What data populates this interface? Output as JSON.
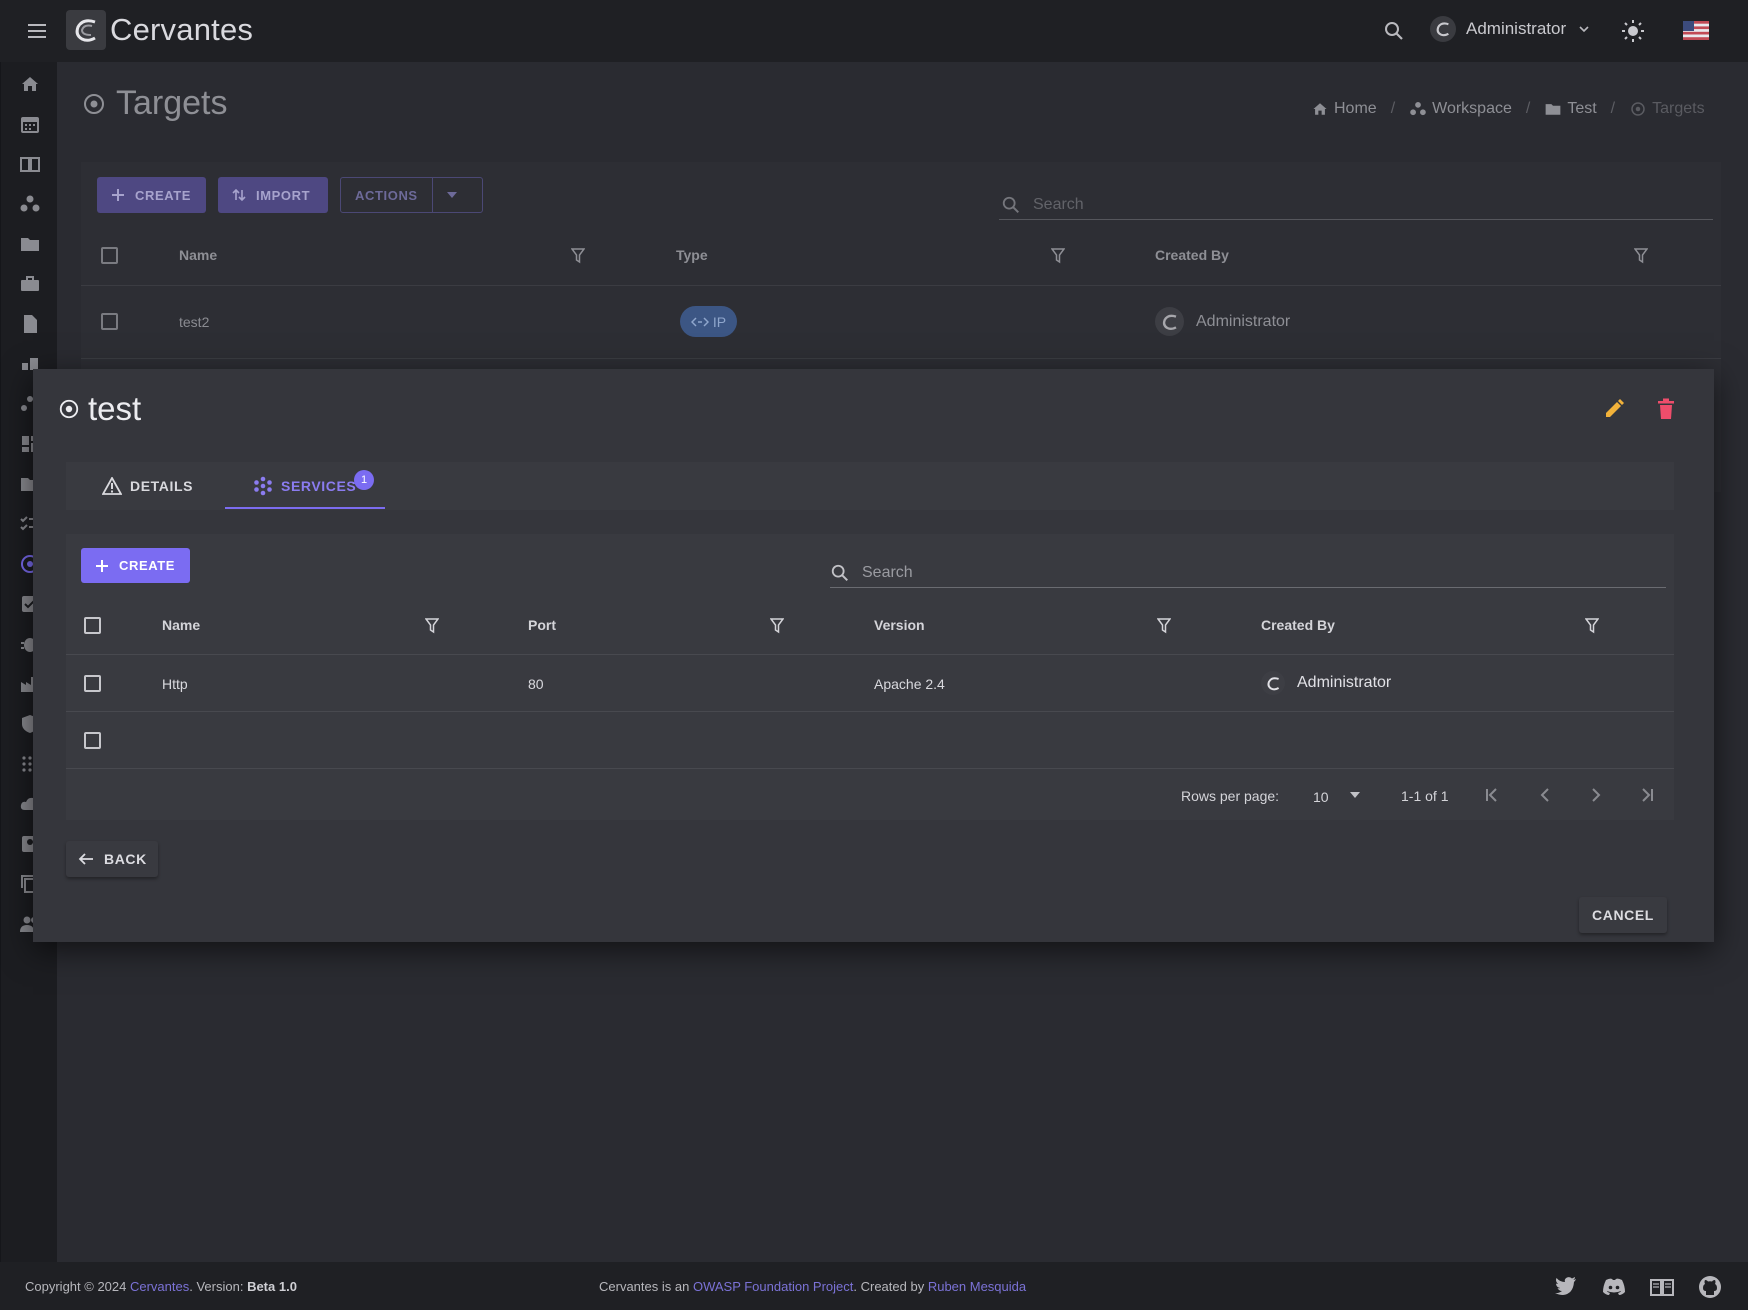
{
  "app": {
    "name": "Cervantes",
    "user": "Administrator"
  },
  "page": {
    "title": "Targets",
    "breadcrumb": [
      "Home",
      "Workspace",
      "Test",
      "Targets"
    ]
  },
  "targets_toolbar": {
    "create_label": "CREATE",
    "import_label": "IMPORT",
    "actions_label": "ACTIONS",
    "search_placeholder": "Search"
  },
  "targets_table": {
    "columns": [
      "Name",
      "Type",
      "Created By"
    ],
    "rows": [
      {
        "name": "test2",
        "type": "IP",
        "created_by": "Administrator"
      }
    ]
  },
  "dialog": {
    "title": "test",
    "tabs": [
      {
        "label": "DETAILS"
      },
      {
        "label": "SERVICES",
        "badge": "1"
      }
    ],
    "services": {
      "create_label": "CREATE",
      "search_placeholder": "Search",
      "columns": [
        "Name",
        "Port",
        "Version",
        "Created By"
      ],
      "rows": [
        {
          "name": "Http",
          "port": "80",
          "version": "Apache 2.4",
          "created_by": "Administrator"
        }
      ],
      "pagination": {
        "rows_per_page_label": "Rows per page:",
        "rows_per_page_value": "10",
        "range": "1-1 of 1"
      }
    },
    "back_label": "BACK",
    "cancel_label": "CANCEL"
  },
  "footer": {
    "copyright": "Copyright © 2024",
    "brand_link": "Cervantes",
    "version_prefix": ". Version:",
    "version": "Beta 1.0",
    "mid_prefix": "Cervantes is an",
    "owasp_link": "OWASP Foundation Project",
    "created_by_text": ". Created by",
    "author_link": "Ruben Mesquida"
  },
  "colors": {
    "accent": "#7b6cf2",
    "edit": "#f2b23a",
    "delete": "#ee4d6b",
    "chip": "#3c5684"
  }
}
